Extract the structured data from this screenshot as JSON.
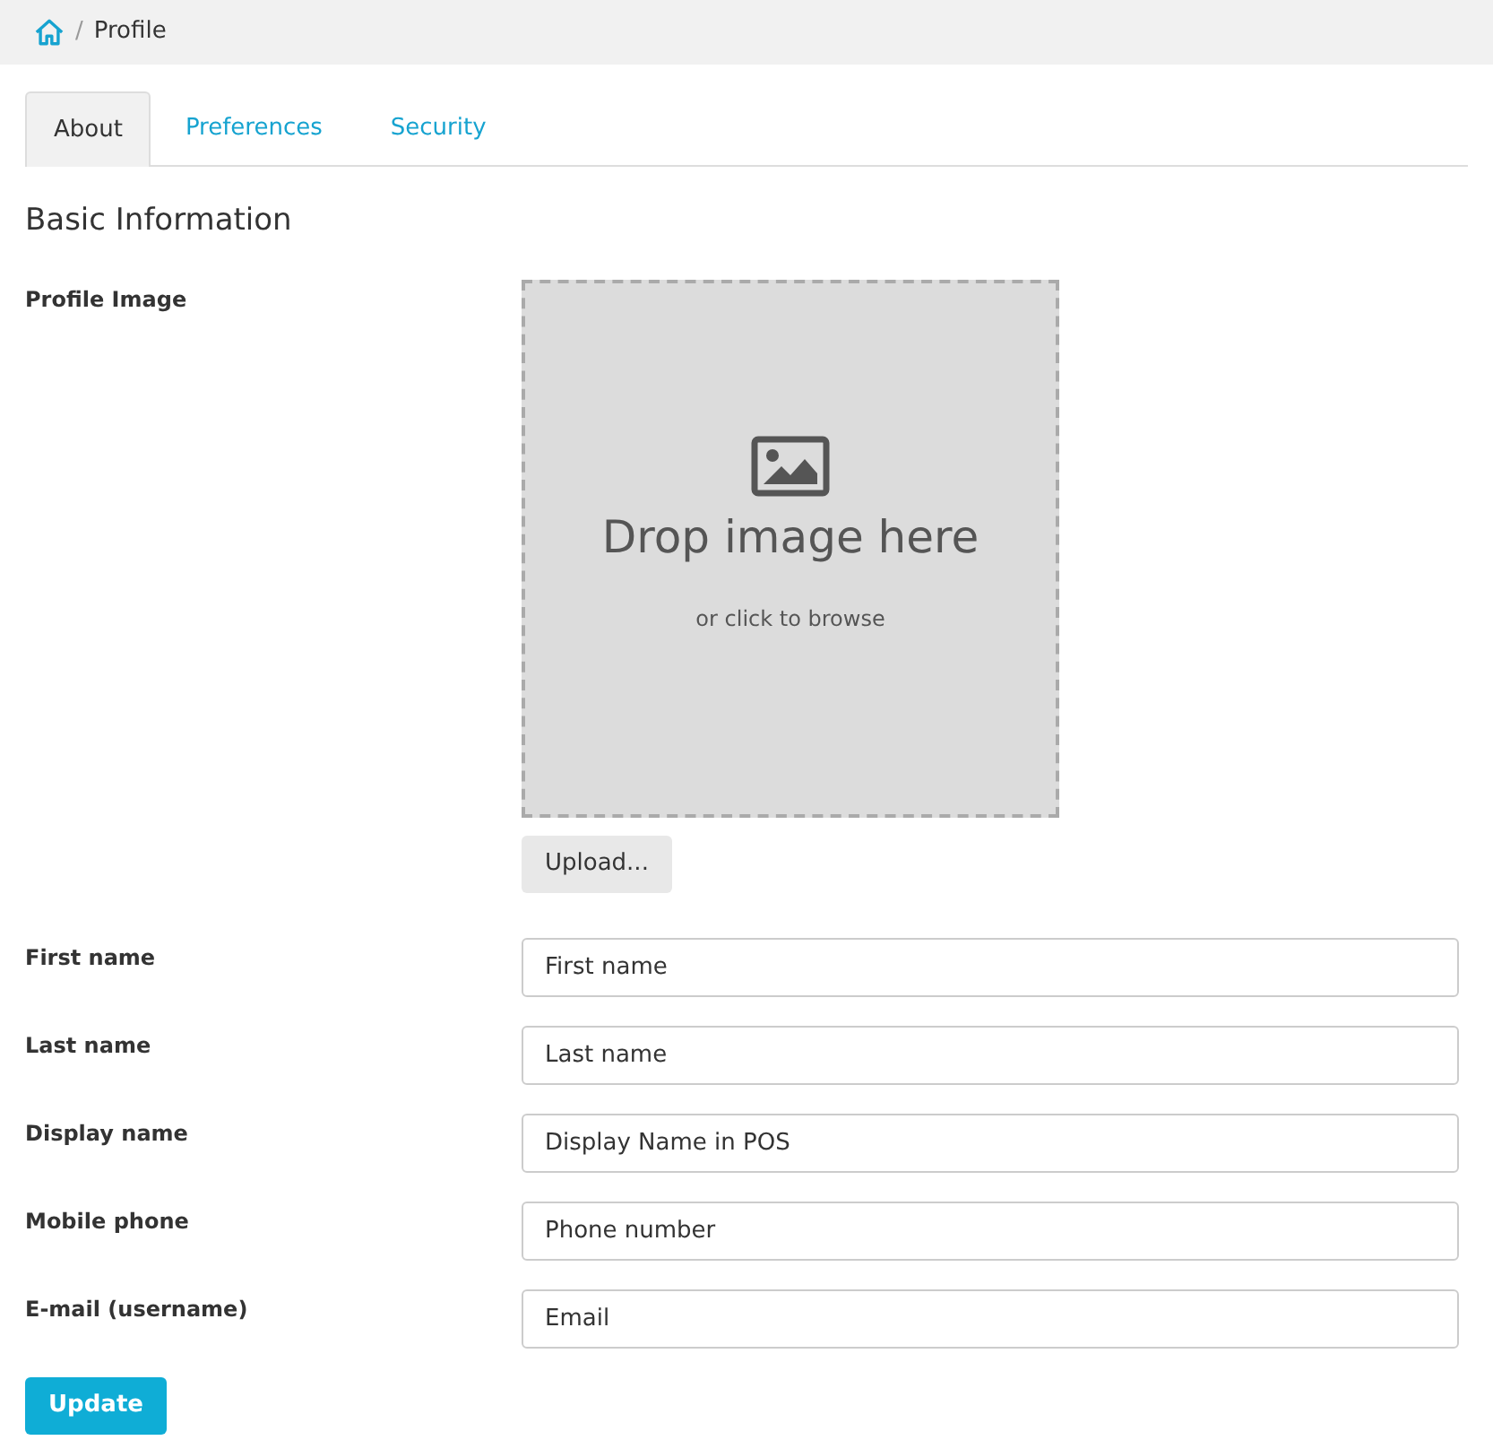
{
  "breadcrumb": {
    "separator": "/",
    "current": "Profile"
  },
  "tabs": [
    {
      "label": "About",
      "selected": true
    },
    {
      "label": "Preferences",
      "selected": false
    },
    {
      "label": "Security",
      "selected": false
    }
  ],
  "section_title": "Basic Information",
  "profile_image": {
    "label": "Profile Image",
    "drop_text": "Drop image here",
    "browse_text": "or click to browse",
    "upload_button": "Upload..."
  },
  "fields": [
    {
      "label": "First name",
      "placeholder": "First name"
    },
    {
      "label": "Last name",
      "placeholder": "Last name"
    },
    {
      "label": "Display name",
      "placeholder": "Display Name in POS"
    },
    {
      "label": "Mobile phone",
      "placeholder": "Phone number"
    },
    {
      "label": "E-mail (username)",
      "placeholder": "Email"
    }
  ],
  "submit_button": "Update"
}
